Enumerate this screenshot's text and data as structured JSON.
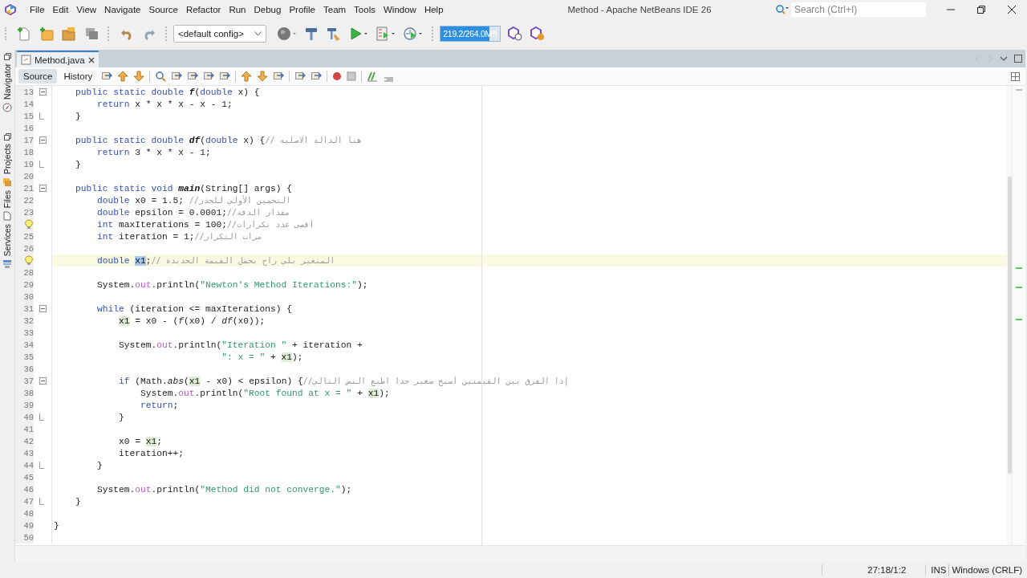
{
  "window": {
    "title": "Method - Apache NetBeans IDE 26"
  },
  "menu": [
    "File",
    "Edit",
    "View",
    "Navigate",
    "Source",
    "Refactor",
    "Run",
    "Debug",
    "Profile",
    "Team",
    "Tools",
    "Window",
    "Help"
  ],
  "search": {
    "placeholder": "Search (Ctrl+I)"
  },
  "toolbar": {
    "config": "<default config>",
    "memory": {
      "reading": "219.2/264.0MB",
      "level": 0.83
    }
  },
  "sidebar": {
    "tabs": [
      {
        "label": "Navigator",
        "kind": "compass"
      },
      {
        "label": "Projects",
        "kind": "projects"
      },
      {
        "label": "Files",
        "kind": "files"
      },
      {
        "label": "Services",
        "kind": "services"
      }
    ]
  },
  "editor_tabs": [
    {
      "label": "Method.java",
      "selected": true
    }
  ],
  "view_tabs": [
    {
      "label": "Source",
      "selected": true
    },
    {
      "label": "History",
      "selected": false
    }
  ],
  "code": [
    {
      "number": "13",
      "kind": "foldstart",
      "hint": false,
      "current": false,
      "tokens": [
        {
          "kind": "kw",
          "text": "    public static double "
        },
        {
          "kind": "def",
          "text": "f"
        },
        {
          "kind": "plain",
          "text": "("
        },
        {
          "kind": "kw",
          "text": "double"
        },
        {
          "kind": "plain",
          "text": " x) {"
        }
      ]
    },
    {
      "number": "14",
      "kind": "line",
      "hint": false,
      "current": false,
      "tokens": [
        {
          "kind": "kw",
          "text": "        return"
        },
        {
          "kind": "plain",
          "text": " x * x * x - x - 1;"
        }
      ]
    },
    {
      "number": "15",
      "kind": "foldend",
      "hint": false,
      "current": false,
      "tokens": [
        {
          "kind": "plain",
          "text": "    }"
        }
      ]
    },
    {
      "number": "16",
      "kind": "line",
      "hint": false,
      "current": false
    },
    {
      "number": "17",
      "kind": "foldstart",
      "hint": false,
      "current": false,
      "tokens": [
        {
          "kind": "kw",
          "text": "    public static double "
        },
        {
          "kind": "def",
          "text": "df"
        },
        {
          "kind": "plain",
          "text": "("
        },
        {
          "kind": "kw",
          "text": "double"
        },
        {
          "kind": "plain",
          "text": " x) {"
        },
        {
          "kind": "cmt",
          "text": "// هنا الدالة الاصلية"
        }
      ]
    },
    {
      "number": "18",
      "kind": "line",
      "hint": false,
      "current": false,
      "tokens": [
        {
          "kind": "kw",
          "text": "        return"
        },
        {
          "kind": "plain",
          "text": " 3 * x * x - 1;"
        }
      ]
    },
    {
      "number": "19",
      "kind": "foldend",
      "hint": false,
      "current": false,
      "tokens": [
        {
          "kind": "plain",
          "text": "    }"
        }
      ]
    },
    {
      "number": "20",
      "kind": "line",
      "hint": false,
      "current": false
    },
    {
      "number": "21",
      "kind": "foldstart",
      "hint": false,
      "current": false,
      "tokens": [
        {
          "kind": "kw",
          "text": "    public static void "
        },
        {
          "kind": "def",
          "text": "main"
        },
        {
          "kind": "plain",
          "text": "(String[] args) {"
        }
      ]
    },
    {
      "number": "22",
      "kind": "line",
      "hint": false,
      "current": false,
      "tokens": [
        {
          "kind": "kw",
          "text": "        double"
        },
        {
          "kind": "plain",
          "text": " x0 = 1.5; "
        },
        {
          "kind": "cmt",
          "text": "//التخمين الأولي للجذر"
        }
      ]
    },
    {
      "number": "23",
      "kind": "line",
      "hint": false,
      "current": false,
      "tokens": [
        {
          "kind": "kw",
          "text": "        double"
        },
        {
          "kind": "plain",
          "text": " epsilon = 0.0001;"
        },
        {
          "kind": "cmt",
          "text": "//مقدار الدقة"
        }
      ]
    },
    {
      "kind": "line",
      "hint": true,
      "current": false,
      "tokens": [
        {
          "kind": "kw",
          "text": "        int"
        },
        {
          "kind": "plain",
          "text": " maxIterations = 100;"
        },
        {
          "kind": "cmt",
          "text": "//أقصى عدد تكرارات"
        }
      ]
    },
    {
      "number": "25",
      "kind": "line",
      "hint": false,
      "current": false,
      "tokens": [
        {
          "kind": "kw",
          "text": "        int"
        },
        {
          "kind": "plain",
          "text": " iteration = 1;"
        },
        {
          "kind": "cmt",
          "text": "//مرات التكرار"
        }
      ]
    },
    {
      "number": "26",
      "kind": "line",
      "hint": false,
      "current": false
    },
    {
      "kind": "line",
      "hint": true,
      "current": true,
      "tokens": [
        {
          "kind": "kw",
          "text": "        double "
        },
        {
          "kind": "sel",
          "text": "x1"
        },
        {
          "kind": "plain",
          "text": ";"
        },
        {
          "kind": "cmt",
          "text": "// المتغير يلي راح يحمل القيمة الجديدة"
        }
      ]
    },
    {
      "number": "28",
      "kind": "line",
      "hint": false,
      "current": false
    },
    {
      "number": "29",
      "kind": "line",
      "hint": false,
      "current": false,
      "tokens": [
        {
          "kind": "plain",
          "text": "        System."
        },
        {
          "kind": "field",
          "text": "out"
        },
        {
          "kind": "plain",
          "text": ".println("
        },
        {
          "kind": "str",
          "text": "\"Newton's Method Iterations:\""
        },
        {
          "kind": "plain",
          "text": ");"
        }
      ]
    },
    {
      "number": "30",
      "kind": "line",
      "hint": false,
      "current": false
    },
    {
      "number": "31",
      "kind": "foldstart",
      "hint": false,
      "current": false,
      "tokens": [
        {
          "kind": "kw",
          "text": "        while"
        },
        {
          "kind": "plain",
          "text": " (iteration <= maxIterations) {"
        }
      ]
    },
    {
      "number": "32",
      "kind": "line",
      "hint": false,
      "current": false,
      "tokens": [
        {
          "kind": "occ",
          "text": "            x1"
        },
        {
          "kind": "plain",
          "text": " = x0 - ("
        },
        {
          "kind": "call",
          "text": "f"
        },
        {
          "kind": "plain",
          "text": "(x0) / "
        },
        {
          "kind": "call",
          "text": "df"
        },
        {
          "kind": "plain",
          "text": "(x0));"
        }
      ]
    },
    {
      "number": "33",
      "kind": "line",
      "hint": false,
      "current": false
    },
    {
      "number": "34",
      "kind": "line",
      "hint": false,
      "current": false,
      "tokens": [
        {
          "kind": "plain",
          "text": "            System."
        },
        {
          "kind": "field",
          "text": "out"
        },
        {
          "kind": "plain",
          "text": ".println("
        },
        {
          "kind": "str",
          "text": "\"Iteration \""
        },
        {
          "kind": "plain",
          "text": " + iteration +"
        }
      ]
    },
    {
      "number": "35",
      "kind": "line",
      "hint": false,
      "current": false,
      "tokens": [
        {
          "kind": "str",
          "text": "                               \": x = \""
        },
        {
          "kind": "plain",
          "text": " + "
        },
        {
          "kind": "occ",
          "text": "x1"
        },
        {
          "kind": "plain",
          "text": ");"
        }
      ]
    },
    {
      "number": "36",
      "kind": "line",
      "hint": false,
      "current": false
    },
    {
      "number": "37",
      "kind": "foldstart",
      "hint": false,
      "current": false,
      "tokens": [
        {
          "kind": "kw",
          "text": "            if"
        },
        {
          "kind": "plain",
          "text": " (Math."
        },
        {
          "kind": "call",
          "text": "abs"
        },
        {
          "kind": "plain",
          "text": "("
        },
        {
          "kind": "occ",
          "text": "x1"
        },
        {
          "kind": "plain",
          "text": " - x0) < epsilon) {"
        },
        {
          "kind": "cmt",
          "text": "//إذا الفرق بين القيمتين أصبح صغير جدا اطبع النص التالي"
        }
      ]
    },
    {
      "number": "38",
      "kind": "line",
      "hint": false,
      "current": false,
      "tokens": [
        {
          "kind": "plain",
          "text": "                System."
        },
        {
          "kind": "field",
          "text": "out"
        },
        {
          "kind": "plain",
          "text": ".println("
        },
        {
          "kind": "str",
          "text": "\"Root found at x = \""
        },
        {
          "kind": "plain",
          "text": " + "
        },
        {
          "kind": "occ",
          "text": "x1"
        },
        {
          "kind": "plain",
          "text": ");"
        }
      ]
    },
    {
      "number": "39",
      "kind": "line",
      "hint": false,
      "current": false,
      "tokens": [
        {
          "kind": "kw",
          "text": "                return"
        },
        {
          "kind": "plain",
          "text": ";"
        }
      ]
    },
    {
      "number": "40",
      "kind": "foldend",
      "hint": false,
      "current": false,
      "tokens": [
        {
          "kind": "plain",
          "text": "            }"
        }
      ]
    },
    {
      "number": "41",
      "kind": "line",
      "hint": false,
      "current": false
    },
    {
      "number": "42",
      "kind": "line",
      "hint": false,
      "current": false,
      "tokens": [
        {
          "kind": "plain",
          "text": "            x0 = "
        },
        {
          "kind": "occ",
          "text": "x1"
        },
        {
          "kind": "plain",
          "text": ";"
        }
      ]
    },
    {
      "number": "43",
      "kind": "line",
      "hint": false,
      "current": false,
      "tokens": [
        {
          "kind": "plain",
          "text": "            iteration++;"
        }
      ]
    },
    {
      "number": "44",
      "kind": "foldend",
      "hint": false,
      "current": false,
      "tokens": [
        {
          "kind": "plain",
          "text": "        }"
        }
      ]
    },
    {
      "number": "45",
      "kind": "line",
      "hint": false,
      "current": false
    },
    {
      "number": "46",
      "kind": "line",
      "hint": false,
      "current": false,
      "tokens": [
        {
          "kind": "plain",
          "text": "        System."
        },
        {
          "kind": "field",
          "text": "out"
        },
        {
          "kind": "plain",
          "text": ".println("
        },
        {
          "kind": "str",
          "text": "\"Method did not converge.\""
        },
        {
          "kind": "plain",
          "text": ");"
        }
      ]
    },
    {
      "number": "47",
      "kind": "foldend",
      "hint": false,
      "current": false,
      "tokens": [
        {
          "kind": "plain",
          "text": "    }"
        }
      ]
    },
    {
      "number": "48",
      "kind": "line",
      "hint": false,
      "current": false
    },
    {
      "number": "49",
      "kind": "line",
      "hint": false,
      "current": false,
      "tokens": [
        {
          "kind": "plain",
          "text": "}"
        }
      ]
    },
    {
      "number": "50",
      "kind": "line",
      "hint": false,
      "current": false
    }
  ],
  "status_bar": {
    "position": "27:18/1:2",
    "mode": "INS",
    "line_endings": "Windows (CRLF)"
  }
}
